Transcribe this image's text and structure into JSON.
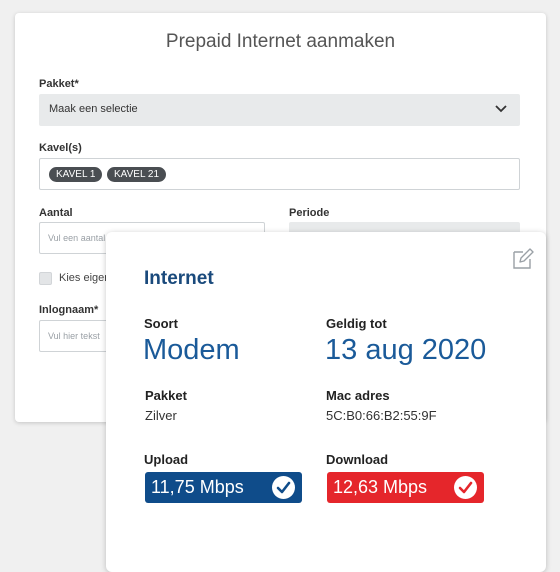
{
  "form": {
    "title": "Prepaid Internet aanmaken",
    "pakket_label": "Pakket",
    "required_mark": "*",
    "pakket_value": "Maak een selectie",
    "kavels_label": "Kavel(s)",
    "kavel_tags": [
      "KAVEL 1",
      "KAVEL 21"
    ],
    "aantal_label": "Aantal",
    "aantal_placeholder": "Vul een aantal",
    "periode_label": "Periode",
    "kies_label": "Kies eigen",
    "inlognaam_label": "Inlognaam",
    "inlognaam_placeholder": "Vul hier tekst"
  },
  "card": {
    "title": "Internet",
    "soort_label": "Soort",
    "soort_value": "Modem",
    "geldig_label": "Geldig tot",
    "geldig_value": "13 aug 2020",
    "pakket_label": "Pakket",
    "pakket_value": "Zilver",
    "mac_label": "Mac adres",
    "mac_value": "5C:B0:66:B2:55:9F",
    "upload_label": "Upload",
    "upload_value": "11,75 Mbps",
    "download_label": "Download",
    "download_value": "12,63 Mbps"
  },
  "colors": {
    "upload": "#0f4c8a",
    "download": "#e5262b",
    "title_blue": "#1a4a7c"
  },
  "icons": {
    "edit": "edit-icon",
    "chevron": "chevron-down-icon",
    "check": "check-circle-icon"
  }
}
